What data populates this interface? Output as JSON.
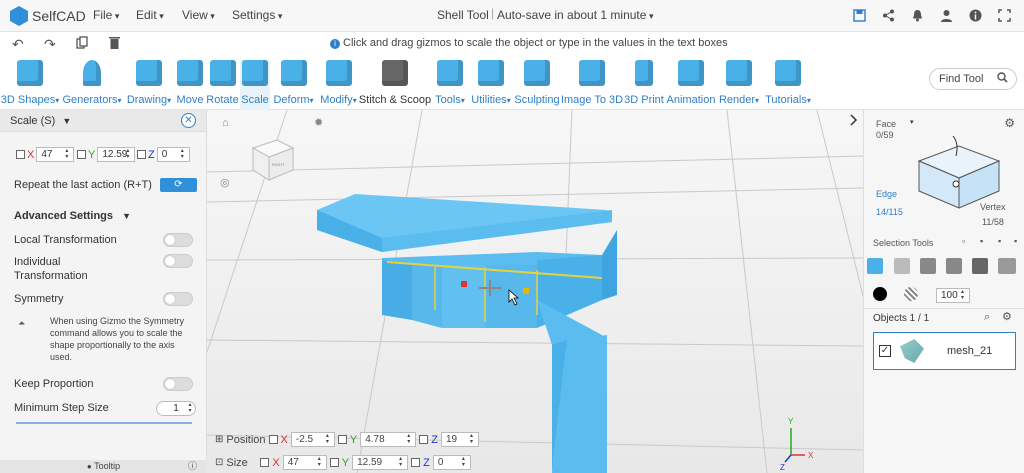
{
  "app": {
    "brand": "SelfCAD",
    "menus": [
      "File",
      "Edit",
      "View",
      "Settings"
    ],
    "doc_title": "Shell Tool",
    "autosave": "Auto-save in about 1 minute"
  },
  "hint": "Click and drag gizmos to scale the object or type in the values in the text boxes",
  "toolbar": {
    "items": [
      {
        "label": "3D Shapes",
        "dropdown": true
      },
      {
        "label": "Generators",
        "dropdown": true
      },
      {
        "label": "Drawing",
        "dropdown": true
      },
      {
        "label": "Move",
        "dropdown": false
      },
      {
        "label": "Rotate",
        "dropdown": false
      },
      {
        "label": "Scale",
        "dropdown": false
      },
      {
        "label": "Deform",
        "dropdown": true
      },
      {
        "label": "Modify",
        "dropdown": true
      },
      {
        "label": "Stitch & Scoop",
        "dropdown": false
      },
      {
        "label": "Tools",
        "dropdown": true
      },
      {
        "label": "Utilities",
        "dropdown": true
      },
      {
        "label": "Sculpting",
        "dropdown": false
      },
      {
        "label": "Image To 3D",
        "dropdown": false
      },
      {
        "label": "3D Print",
        "dropdown": false
      },
      {
        "label": "Animation",
        "dropdown": false
      },
      {
        "label": "Render",
        "dropdown": true
      },
      {
        "label": "Tutorials",
        "dropdown": true
      }
    ],
    "find_tool": "Find Tool"
  },
  "scale_panel": {
    "title": "Scale (S)",
    "x_label": "X",
    "x_value": "47",
    "y_label": "Y",
    "y_value": "12.59",
    "z_label": "Z",
    "z_value": "0",
    "repeat_label": "Repeat the last action (R+T)",
    "advanced_label": "Advanced Settings",
    "local_transformation": "Local Transformation",
    "individual_transformation": "Individual Transformation",
    "symmetry": "Symmetry",
    "symmetry_note": "When using Gizmo the Symmetry command allows you to scale the shape proportionally to the axis used.",
    "keep_proportion": "Keep Proportion",
    "min_step_label": "Minimum Step Size",
    "min_step_value": "1",
    "tooltip_label": "Tooltip"
  },
  "viewport": {
    "position_label": "Position",
    "position": {
      "x": "-2.5",
      "y": "4.78",
      "z": "19"
    },
    "size_label": "Size",
    "size": {
      "x": "47",
      "y": "12.59",
      "z": "0"
    },
    "cube_label": "RIGHT"
  },
  "right_panel": {
    "face_label": "Face",
    "face_count": "0/59",
    "edge_label": "Edge",
    "edge_count": "14/115",
    "vertex_label": "Vertex",
    "vertex_count": "11/58",
    "selection_tools": "Selection Tools",
    "brush_size": "100",
    "objects_label": "Objects 1 / 1",
    "object_name": "mesh_21"
  },
  "colors": {
    "accent": "#2f7fc8",
    "model": "#5bbcf0",
    "selection_edge": "#e6d23a"
  }
}
